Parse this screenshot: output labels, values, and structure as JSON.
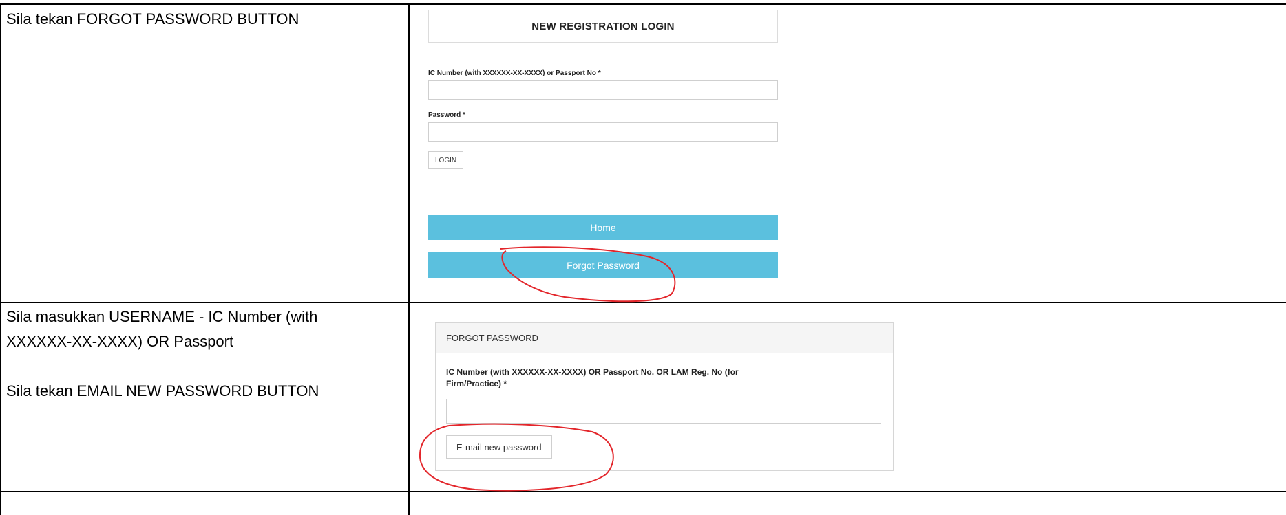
{
  "rows": [
    {
      "instruction_lines": [
        "Sila tekan FORGOT PASSWORD BUTTON"
      ],
      "screenshot": {
        "title": "NEW REGISTRATION LOGIN",
        "ic_label": "IC Number (with XXXXXX-XX-XXXX) or Passport No *",
        "password_label": "Password *",
        "login_button": "LOGIN",
        "home_button": "Home",
        "forgot_button": "Forgot Password"
      }
    },
    {
      "instruction_lines": [
        "Sila masukkan USERNAME - IC Number (with",
        "XXXXXX-XX-XXXX) OR Passport",
        "Sila tekan EMAIL NEW PASSWORD BUTTON"
      ],
      "screenshot": {
        "panel_title": "FORGOT PASSWORD",
        "field_label_line1": "IC Number (with XXXXXX-XX-XXXX) OR Passport No. OR LAM Reg. No (for",
        "field_label_line2": "Firm/Practice) *",
        "email_button": "E-mail new password"
      }
    },
    {
      "instruction_lines": []
    }
  ],
  "colors": {
    "button_blue": "#5bc0de",
    "annotation_red": "#e3262b",
    "table_border": "#000000"
  }
}
